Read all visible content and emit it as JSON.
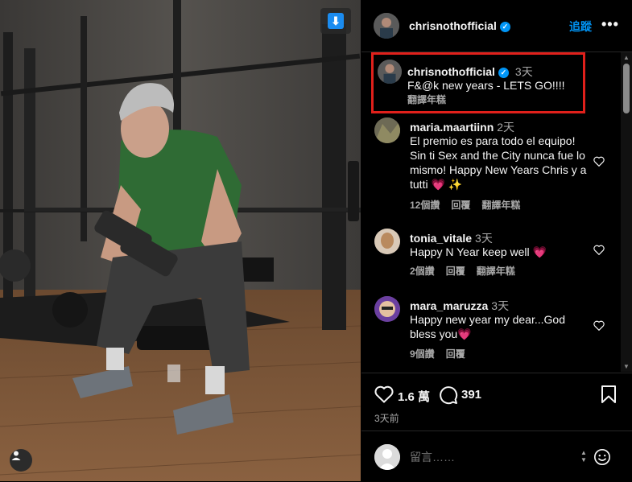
{
  "post": {
    "author": "chrisnothofficial",
    "follow_label": "追蹤",
    "more_label": "•••",
    "caption": {
      "author": "chrisnothofficial",
      "time": "3天",
      "text": "F&@k new years - LETS GO!!!!",
      "translate": "翻譯年糕"
    }
  },
  "comments": [
    {
      "user": "maria.maartiinn",
      "time": "2天",
      "text": "El premio es para todo el equipo! Sin ti Sex and the City nunca fue lo mismo! Happy New Years Chris y a tutti 💗 ✨",
      "likes": "12個讚",
      "reply": "回覆",
      "translate": "翻譯年糕"
    },
    {
      "user": "tonia_vitale",
      "time": "3天",
      "text": "Happy N Year keep well 💗",
      "likes": "2個讚",
      "reply": "回覆",
      "translate": "翻譯年糕"
    },
    {
      "user": "mara_maruzza",
      "time": "3天",
      "text": "Happy new year my dear...God bless you💗",
      "likes": "9個讚",
      "reply": "回覆",
      "translate": ""
    }
  ],
  "actions": {
    "like_count": "1.6 萬",
    "comment_count": "391",
    "posted": "3天前"
  },
  "composer": {
    "placeholder": "留言……"
  },
  "icons": {
    "save_badge": "download-arrow-icon",
    "user_tag": "person-icon",
    "heart": "heart-icon",
    "comment": "comment-icon",
    "bookmark": "bookmark-icon",
    "emoji": "emoji-icon"
  },
  "colors": {
    "accent": "#0095f6",
    "highlight_box": "#e0201b",
    "background": "#000000"
  }
}
